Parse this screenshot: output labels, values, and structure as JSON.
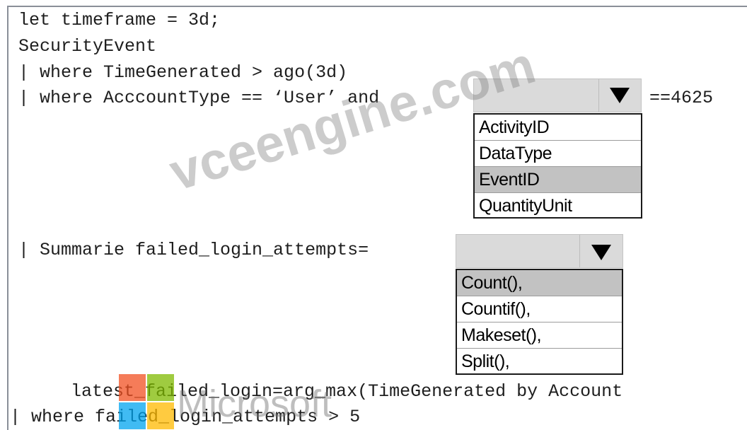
{
  "code": {
    "line1": "let timeframe = 3d;",
    "line2": "SecurityEvent",
    "line3": "| where TimeGenerated > ago(3d)",
    "line4_prefix": "| where AcccountType == ‘User’ and",
    "line4_suffix": "==4625",
    "line5_prefix": "| Summarie failed_login_attempts=",
    "line6": "latest_failed_login=arg_max(TimeGenerated by Account",
    "line7": "| where failed_login_attempts > 5"
  },
  "dropdown1": {
    "selected": "",
    "options": [
      "ActivityID",
      "DataType",
      "EventID",
      "QuantityUnit"
    ],
    "highlighted": "EventID"
  },
  "dropdown2": {
    "selected": "",
    "options": [
      "Count(),",
      "Countif(),",
      "Makeset(),",
      "Split(),"
    ],
    "highlighted": "Count(),"
  },
  "watermarks": {
    "site": "vceengine.com",
    "brand": "Microsoft",
    "logo_colors": [
      "#f25022",
      "#7fba00",
      "#00a4ef",
      "#ffb900"
    ]
  }
}
